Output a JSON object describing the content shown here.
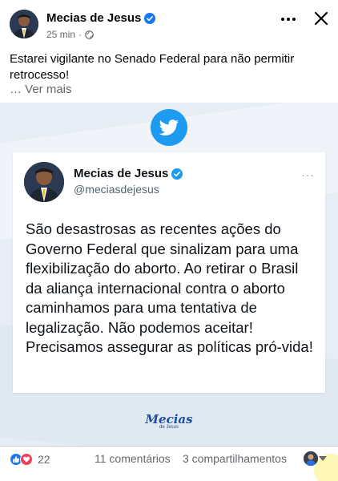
{
  "post": {
    "author": "Mecias de Jesus",
    "time": "25 min",
    "separator": "·",
    "caption": "Estarei vigilante no Senado Federal para não permitir retrocesso!",
    "see_more": "… Ver mais"
  },
  "tweet": {
    "name": "Mecias de Jesus",
    "handle": "@meciasdejesus",
    "more": "···",
    "text": "São desastrosas as recentes ações do Governo Federal que sinalizam para uma flexibilização do aborto. Ao retirar o Brasil da aliança internacional contra o aborto caminhamos para uma tentativa de legalização. Não podemos aceitar! Precisamos assegurar as políticas pró-vida!"
  },
  "signature": {
    "main": "Mecias",
    "sub": "de Jesus"
  },
  "footer": {
    "reaction_count": "22",
    "comments": "11 comentários",
    "shares": "3 compartilhamentos"
  },
  "icons": {
    "verified": "verified-badge-icon",
    "globe": "globe-icon",
    "more": "more-horizontal-icon",
    "close": "close-icon",
    "twitter": "twitter-bird-icon",
    "like": "like-reaction-icon",
    "love": "love-reaction-icon",
    "caret": "caret-down-icon"
  },
  "colors": {
    "facebook_blue": "#1877f2",
    "twitter_blue": "#1d9bf0",
    "love_red": "#f33e58",
    "secondary_text": "#65676b",
    "signature_blue": "#1d4e9a"
  }
}
